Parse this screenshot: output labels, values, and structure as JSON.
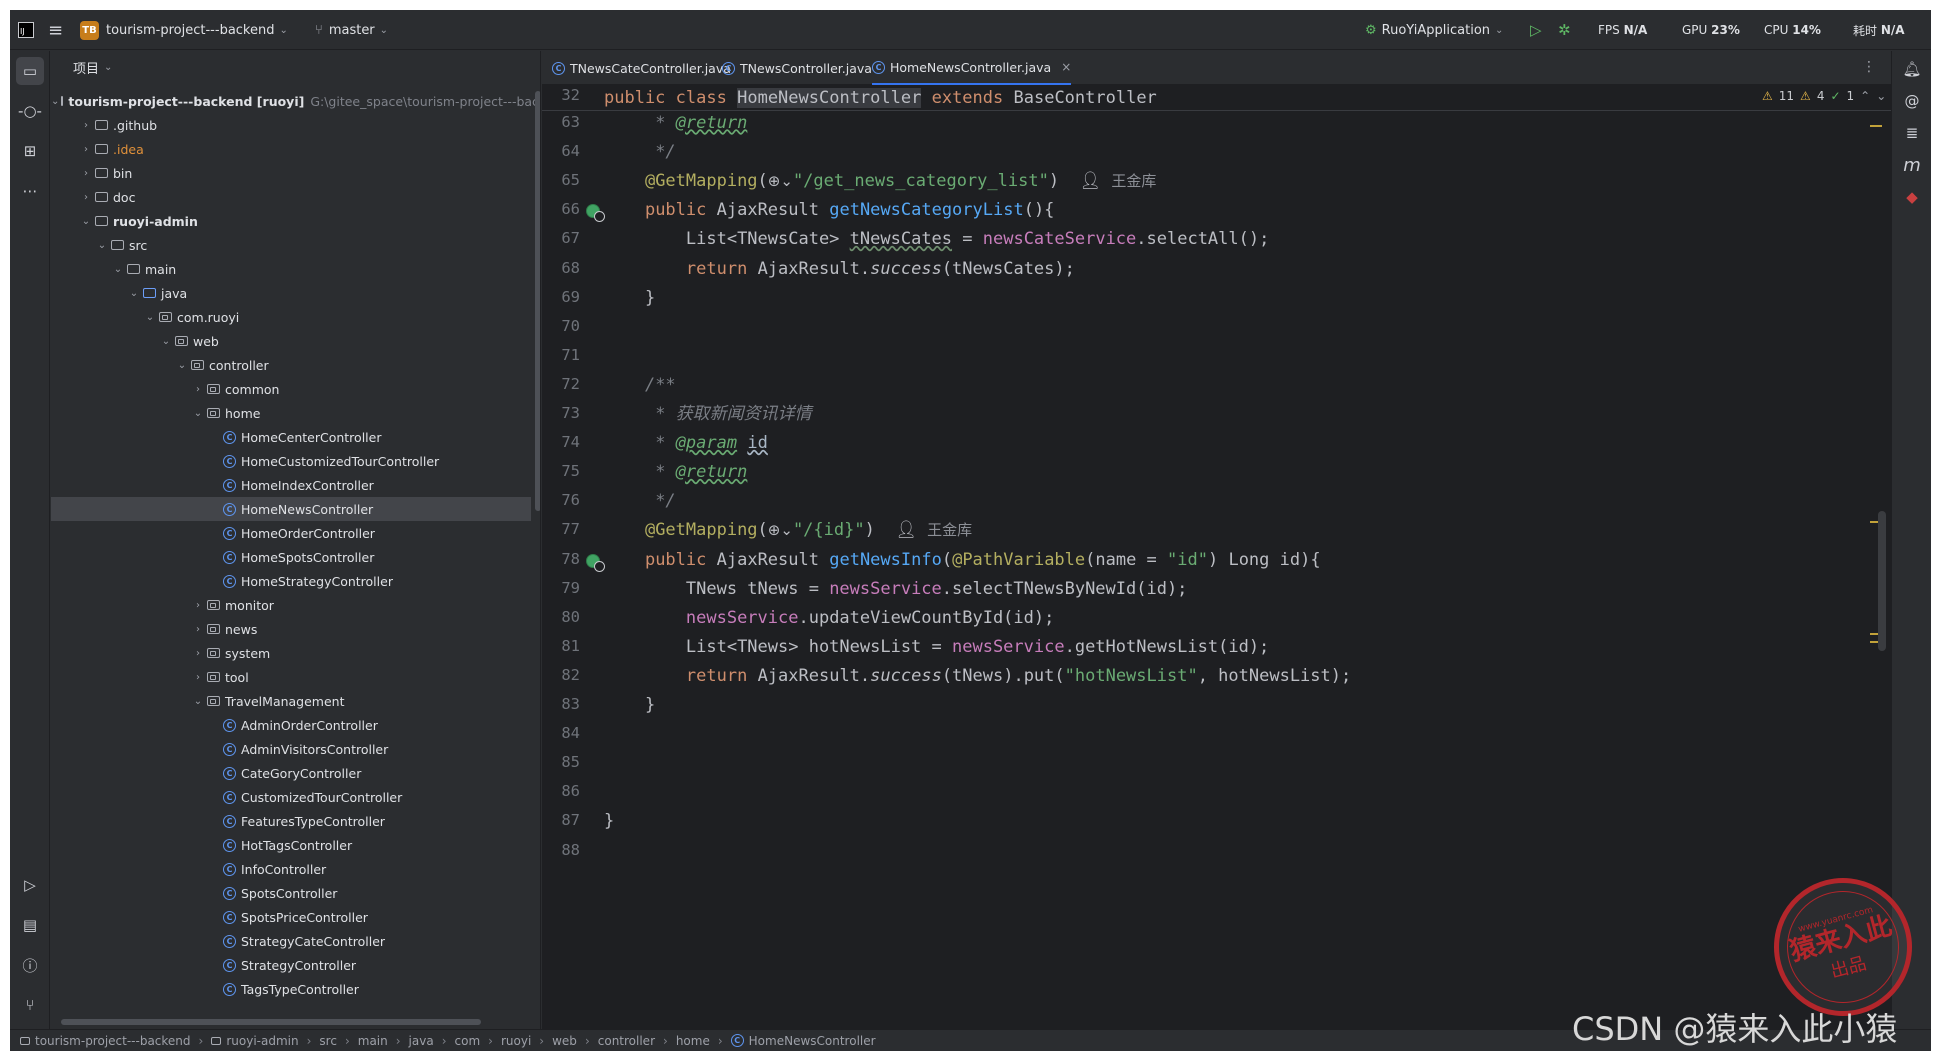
{
  "titlebar": {
    "project_badge": "TB",
    "project_name": "tourism-project---backend",
    "branch": "master",
    "run_config": "RuoYiApplication",
    "fps_label": "FPS",
    "fps_value": "N/A",
    "gpu_label": "GPU",
    "gpu_value": "23%",
    "cpu_label": "CPU",
    "cpu_value": "14%",
    "time_label": "耗时",
    "time_value": "N/A"
  },
  "project_panel": {
    "title": "项目",
    "tree": [
      {
        "depth": 0,
        "type": "project",
        "open": true,
        "label": "tourism-project---backend [ruoyi]",
        "path": "G:\\gitee_space\\tourism-project---back",
        "bold": true
      },
      {
        "depth": 1,
        "type": "folder",
        "open": false,
        "label": ".github"
      },
      {
        "depth": 1,
        "type": "folder",
        "open": false,
        "label": ".idea",
        "orange": true
      },
      {
        "depth": 1,
        "type": "folder",
        "open": false,
        "label": "bin"
      },
      {
        "depth": 1,
        "type": "folder",
        "open": false,
        "label": "doc"
      },
      {
        "depth": 1,
        "type": "module",
        "open": true,
        "label": "ruoyi-admin",
        "bold": true
      },
      {
        "depth": 2,
        "type": "folder",
        "open": true,
        "label": "src"
      },
      {
        "depth": 3,
        "type": "folder",
        "open": true,
        "label": "main"
      },
      {
        "depth": 4,
        "type": "source",
        "open": true,
        "label": "java"
      },
      {
        "depth": 5,
        "type": "package",
        "open": true,
        "label": "com.ruoyi"
      },
      {
        "depth": 6,
        "type": "package",
        "open": true,
        "label": "web"
      },
      {
        "depth": 7,
        "type": "package",
        "open": true,
        "label": "controller"
      },
      {
        "depth": 8,
        "type": "package",
        "open": false,
        "label": "common"
      },
      {
        "depth": 8,
        "type": "package",
        "open": true,
        "label": "home"
      },
      {
        "depth": 9,
        "type": "class",
        "label": "HomeCenterController"
      },
      {
        "depth": 9,
        "type": "class",
        "label": "HomeCustomizedTourController"
      },
      {
        "depth": 9,
        "type": "class",
        "label": "HomeIndexController"
      },
      {
        "depth": 9,
        "type": "class",
        "label": "HomeNewsController",
        "selected": true
      },
      {
        "depth": 9,
        "type": "class",
        "label": "HomeOrderController"
      },
      {
        "depth": 9,
        "type": "class",
        "label": "HomeSpotsController"
      },
      {
        "depth": 9,
        "type": "class",
        "label": "HomeStrategyController"
      },
      {
        "depth": 8,
        "type": "package",
        "open": false,
        "label": "monitor"
      },
      {
        "depth": 8,
        "type": "package",
        "open": false,
        "label": "news"
      },
      {
        "depth": 8,
        "type": "package",
        "open": false,
        "label": "system"
      },
      {
        "depth": 8,
        "type": "package",
        "open": false,
        "label": "tool"
      },
      {
        "depth": 8,
        "type": "package",
        "open": true,
        "label": "TravelManagement"
      },
      {
        "depth": 9,
        "type": "class",
        "label": "AdminOrderController"
      },
      {
        "depth": 9,
        "type": "class",
        "label": "AdminVisitorsController"
      },
      {
        "depth": 9,
        "type": "class",
        "label": "CateGoryController"
      },
      {
        "depth": 9,
        "type": "class",
        "label": "CustomizedTourController"
      },
      {
        "depth": 9,
        "type": "class",
        "label": "FeaturesTypeController"
      },
      {
        "depth": 9,
        "type": "class",
        "label": "HotTagsController"
      },
      {
        "depth": 9,
        "type": "class",
        "label": "InfoController"
      },
      {
        "depth": 9,
        "type": "class",
        "label": "SpotsController"
      },
      {
        "depth": 9,
        "type": "class",
        "label": "SpotsPriceController"
      },
      {
        "depth": 9,
        "type": "class",
        "label": "StrategyCateController"
      },
      {
        "depth": 9,
        "type": "class",
        "label": "StrategyController"
      },
      {
        "depth": 9,
        "type": "class",
        "label": "TagsTypeController"
      }
    ]
  },
  "editor": {
    "tabs": [
      {
        "label": "TNewsCateController.java",
        "active": false
      },
      {
        "label": "TNewsController.java",
        "active": false
      },
      {
        "label": "HomeNewsController.java",
        "active": true
      }
    ],
    "inspection": {
      "warnings": "11",
      "weak_warnings": "4",
      "ok": "1"
    },
    "sticky": {
      "line": "32"
    },
    "lines": [
      {
        "n": "63",
        "gutter": ""
      },
      {
        "n": "64",
        "gutter": ""
      },
      {
        "n": "65",
        "gutter": ""
      },
      {
        "n": "66",
        "gutter": "web"
      },
      {
        "n": "67",
        "gutter": ""
      },
      {
        "n": "68",
        "gutter": ""
      },
      {
        "n": "69",
        "gutter": ""
      },
      {
        "n": "70",
        "gutter": ""
      },
      {
        "n": "71",
        "gutter": ""
      },
      {
        "n": "72",
        "gutter": ""
      },
      {
        "n": "73",
        "gutter": ""
      },
      {
        "n": "74",
        "gutter": ""
      },
      {
        "n": "75",
        "gutter": ""
      },
      {
        "n": "76",
        "gutter": ""
      },
      {
        "n": "77",
        "gutter": ""
      },
      {
        "n": "78",
        "gutter": "web"
      },
      {
        "n": "79",
        "gutter": ""
      },
      {
        "n": "80",
        "gutter": ""
      },
      {
        "n": "81",
        "gutter": ""
      },
      {
        "n": "82",
        "gutter": ""
      },
      {
        "n": "83",
        "gutter": ""
      },
      {
        "n": "84",
        "gutter": ""
      },
      {
        "n": "85",
        "gutter": ""
      },
      {
        "n": "86",
        "gutter": ""
      },
      {
        "n": "87",
        "gutter": ""
      },
      {
        "n": "88",
        "gutter": ""
      }
    ],
    "code": {
      "kw_public": "public",
      "kw_class": "class",
      "class_name": "HomeNewsController",
      "kw_extends": "extends",
      "base_class": "BaseController",
      "tag_return": "@return",
      "tag_param": "@param",
      "param_id": "id",
      "comment_star": "*",
      "comment_end": "*/",
      "comment_start": "/**",
      "comment_text": "获取新闻资讯详情",
      "ann_getmapping": "@GetMapping",
      "ann_pathvariable": "@PathVariable",
      "path1": "\"/get_news_category_list\"",
      "path2": "\"/{id}\"",
      "author": "王金库",
      "ret_type": "AjaxResult",
      "m_getNewsCategoryList": "getNewsCategoryList",
      "m_getNewsInfo": "getNewsInfo",
      "list_tnewscate": "List<TNewsCate>",
      "var_tnewscates": "tNewsCates",
      "fld_newsCateService": "newsCateService",
      "call_selectAll": ".selectAll();",
      "kw_return": "return",
      "ajax_success_pre": "AjaxResult.",
      "success": "success",
      "ret1_args": "(tNewsCates);",
      "brace_close": "}",
      "name_eq": "(name = ",
      "str_id": "\"id\"",
      "long_id": ") Long id){",
      "tnews_decl": "TNews tNews = ",
      "fld_newsService": "newsService",
      "call_select": ".selectTNewsByNewId(id);",
      "call_update": ".updateViewCountById(id);",
      "list_tnews_decl": "List<TNews> hotNewsList = ",
      "call_hot": ".getHotNewsList(id);",
      "ret2_args_a": "(tNews).put(",
      "str_hotnews": "\"hotNewsList\"",
      "ret2_args_b": ", hotNewsList);",
      "paren_open_brace": "(){",
      "eq": " = "
    }
  },
  "breadcrumb": [
    "tourism-project---backend",
    "ruoyi-admin",
    "src",
    "main",
    "java",
    "com",
    "ruoyi",
    "web",
    "controller",
    "home",
    "HomeNewsController"
  ],
  "watermark": {
    "text": "CSDN @猿来入此小猿",
    "stamp_top": "www.yuanrc.com",
    "stamp_main": "猿来入此",
    "stamp_bottom": "出品"
  }
}
